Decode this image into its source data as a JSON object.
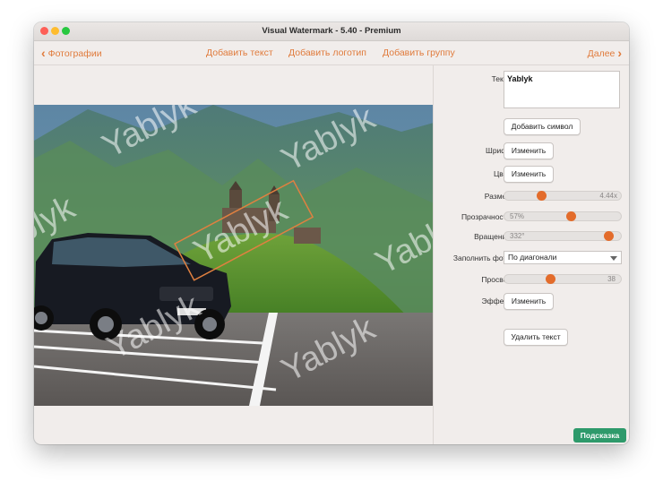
{
  "window": {
    "title": "Visual Watermark - 5.40 - Premium"
  },
  "toolbar": {
    "back_label": "Фотографии",
    "add_text": "Добавить текст",
    "add_logo": "Добавить логотип",
    "add_group": "Добавить группу",
    "next_label": "Далее"
  },
  "photo": {
    "watermark_text": "Yablyk"
  },
  "panel": {
    "text_label": "Текст",
    "text_value": "Yablyk",
    "add_symbol": "Добавить символ",
    "font_label": "Шрифт",
    "font_button": "Изменить",
    "color_label": "Цвет",
    "color_button": "Изменить",
    "size_label": "Размер",
    "size_value": "4.44x",
    "size_level": 0.3,
    "opacity_label": "Прозрачность",
    "opacity_value": "57%",
    "opacity_level": 0.57,
    "rotation_label": "Вращение",
    "rotation_value": "332°",
    "rotation_level": 0.92,
    "fill_label": "Заполнить фото",
    "fill_value": "По диагонали",
    "gap_label": "Просвет",
    "gap_value": "38",
    "gap_level": 0.38,
    "effect_label": "Эффект",
    "effect_button": "Изменить",
    "delete_text": "Удалить текст",
    "hint_button": "Подсказка"
  },
  "colors": {
    "accent": "#e07b3c",
    "slider_knob": "#e36c2b",
    "hint_bg": "#2e9a6b"
  }
}
